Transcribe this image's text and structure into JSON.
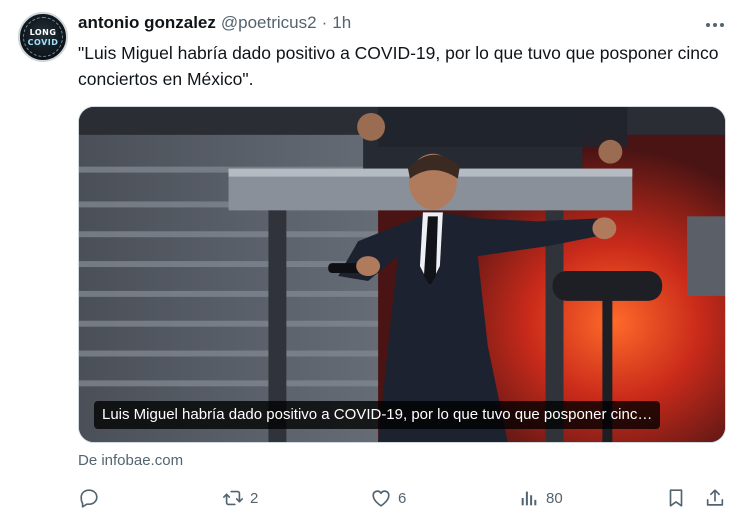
{
  "author": {
    "name": "antonio gonzalez",
    "handle": "@poetricus2",
    "separator": "·",
    "time": "1h",
    "avatar_text_line1": "LONG",
    "avatar_text_line2": "COVID"
  },
  "tweet": {
    "text": "\"Luis Miguel habría dado positivo a COVID-19, por lo que tuvo que posponer cinco conciertos en México\"."
  },
  "media": {
    "caption": "Luis Miguel habría dado positivo a COVID-19, por lo que tuvo que posponer cinc…"
  },
  "card": {
    "source": "De infobae.com"
  },
  "actions": {
    "reply_icon": "reply-icon",
    "retweet_icon": "retweet-icon",
    "retweet_count": "2",
    "like_icon": "heart-icon",
    "like_count": "6",
    "views_icon": "views-icon",
    "views_count": "80",
    "bookmark_icon": "bookmark-icon",
    "share_icon": "share-icon"
  },
  "colors": {
    "text_primary": "#0f1419",
    "text_secondary": "#536471",
    "border": "#cfd9de"
  }
}
